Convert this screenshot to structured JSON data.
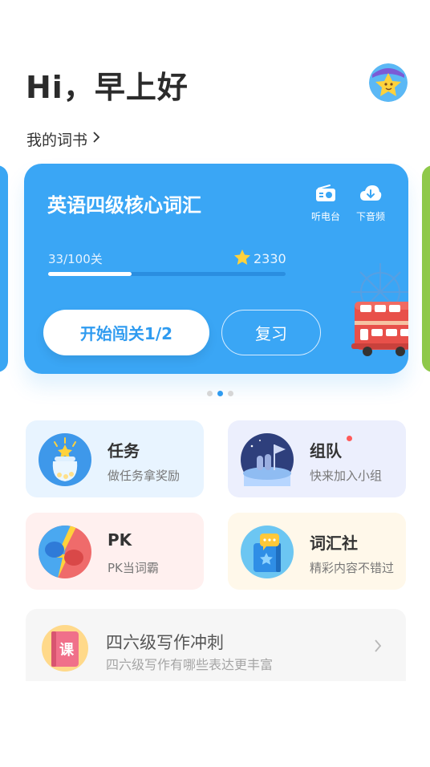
{
  "header": {
    "greeting": "Hi，早上好"
  },
  "my_books": {
    "label": "我的词书",
    "chevron": "chevron-right-icon"
  },
  "book_card": {
    "title": "英语四级核心词汇",
    "tools": [
      {
        "label": "听电台",
        "icon": "radio-icon"
      },
      {
        "label": "下音频",
        "icon": "download-icon"
      }
    ],
    "progress_text": "33/100关",
    "progress_fraction": 0.35,
    "star_count": "2330",
    "start_label": "开始闯关1/2",
    "review_label": "复习",
    "bg_color": "#3aa6f5"
  },
  "carousel": {
    "total": 3,
    "active": 1
  },
  "tiles": [
    {
      "title": "任务",
      "subtitle": "做任务拿奖励",
      "icon": "treasure-jar-icon",
      "bg": "#e8f4ff"
    },
    {
      "title": "组队",
      "subtitle": "快来加入小组",
      "icon": "team-flag-icon",
      "bg": "#eceffd",
      "badge": true
    },
    {
      "title": "PK",
      "subtitle": "PK当词霸",
      "icon": "boxing-gloves-icon",
      "bg": "#fff0ef"
    },
    {
      "title": "词汇社",
      "subtitle": "精彩内容不错过",
      "icon": "vocab-book-icon",
      "bg": "#fff8ea"
    }
  ],
  "banner": {
    "title": "四六级写作冲刺",
    "subtitle": "四六级写作有哪些表达更丰富",
    "icon_text": "课",
    "icon": "course-book-icon"
  }
}
